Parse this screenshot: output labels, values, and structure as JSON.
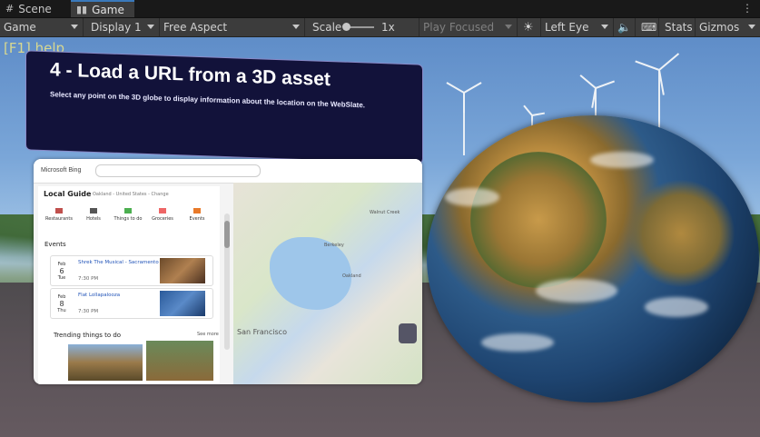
{
  "tabs": [
    {
      "label": "Scene",
      "icon": "grid-icon"
    },
    {
      "label": "Game",
      "icon": "gamepad-icon"
    }
  ],
  "toolbar": {
    "game_mode": "Game",
    "display": "Display 1",
    "aspect": "Free Aspect",
    "scale_label": "Scale",
    "scale_value": "1x",
    "play_focused": "Play Focused",
    "eye": "Left Eye",
    "stats": "Stats",
    "gizmos": "Gizmos"
  },
  "viewport": {
    "help": "[F1] help",
    "banner": {
      "title": "4 - Load a URL from a 3D asset",
      "subtitle": "Select any point on the 3D globe to display information about the location on the WebSlate."
    },
    "browser": {
      "logo": "Microsoft Bing",
      "local_guide": "Local Guide",
      "location": "Oakland - United States - Change",
      "categories": [
        "Restaurants",
        "Hotels",
        "Things to do",
        "Groceries",
        "Events"
      ],
      "events_heading": "Events",
      "events": [
        {
          "month": "Feb",
          "day": "6",
          "weekday": "Tue",
          "name": "Shrek The Musical - Sacramento",
          "time": "7:30 PM"
        },
        {
          "month": "Feb",
          "day": "8",
          "weekday": "Thu",
          "name": "Flat Lollapalooza",
          "time": "7:30 PM"
        }
      ],
      "trending": "Trending things to do",
      "see_more": "See more",
      "map_labels": [
        "Berkeley",
        "Oakland",
        "San Francisco",
        "Walnut Creek"
      ]
    }
  }
}
